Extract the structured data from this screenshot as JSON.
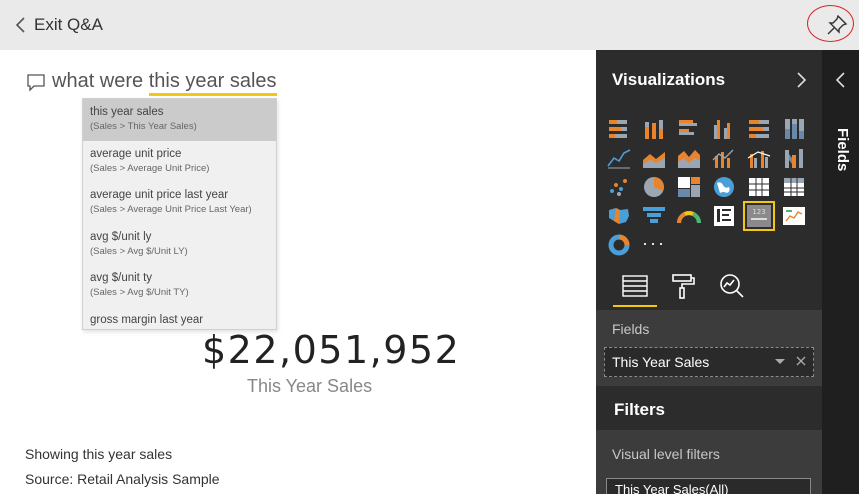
{
  "topbar": {
    "exit_label": "Exit Q&A"
  },
  "qa": {
    "question_prefix": "what were ",
    "question_highlight": "this year sales",
    "suggestions": [
      {
        "title": "this year sales",
        "path": "(Sales > This Year Sales)"
      },
      {
        "title": "average unit price",
        "path": "(Sales > Average Unit Price)"
      },
      {
        "title": "average unit price last year",
        "path": "(Sales > Average Unit Price Last Year)"
      },
      {
        "title": "avg $/unit ly",
        "path": "(Sales > Avg $/Unit LY)"
      },
      {
        "title": "avg $/unit ty",
        "path": "(Sales > Avg $/Unit TY)"
      },
      {
        "title": "gross margin last year",
        "path": ""
      }
    ]
  },
  "result": {
    "value": "$22,051,952",
    "label": "This Year Sales",
    "showing": "Showing this year sales",
    "source": "Source: Retail Analysis Sample"
  },
  "viz_panel": {
    "title": "Visualizations",
    "more": "···",
    "fields_label": "Fields",
    "field_value": "This Year Sales",
    "filters_title": "Filters",
    "visual_filters_label": "Visual level filters",
    "filter_chip": "This Year Sales(All)"
  },
  "fields_panel": {
    "label": "Fields"
  },
  "colors": {
    "accent": "#f2c811",
    "pin_highlight": "#d12b2b",
    "panel_dark": "#2c2c2c",
    "panel_mid": "#3c3c3c"
  }
}
